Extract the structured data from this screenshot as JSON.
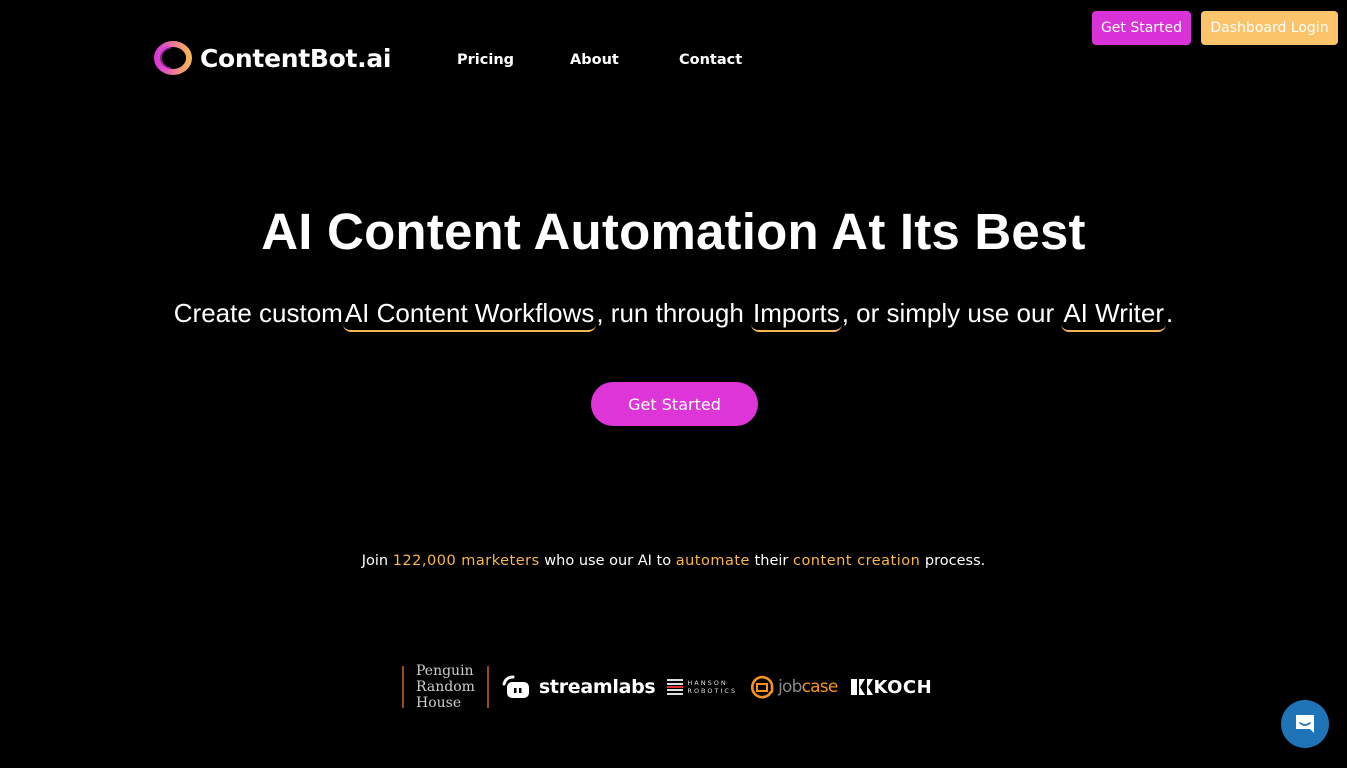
{
  "brand": {
    "name": "ContentBot.ai",
    "colors": {
      "primary": "#d832d8",
      "secondary": "#fbc46a",
      "accent": "#f8b64c",
      "chat": "#1f73b7"
    }
  },
  "nav": {
    "items": [
      {
        "label": "Pricing"
      },
      {
        "label": "About"
      },
      {
        "label": "Contact"
      }
    ]
  },
  "header_buttons": {
    "get_started": "Get Started",
    "dashboard_login": "Dashboard Login"
  },
  "hero": {
    "title": "AI Content Automation At Its Best",
    "subtitle": {
      "part1": "Create custom",
      "highlight1": "AI Content Workflows",
      "part2": ", run through ",
      "highlight2": "Imports",
      "part3": ", or simply use our ",
      "highlight3": "AI Writer",
      "part4": "."
    },
    "cta": "Get Started"
  },
  "social_proof": {
    "join": "Join ",
    "count": "122,000 marketers",
    "t1": " who use our AI to ",
    "automate": "automate",
    "t2": " their ",
    "content_creation": "content creation",
    "t3": " process."
  },
  "client_logos": {
    "penguin": [
      "Penguin",
      "Random",
      "House"
    ],
    "streamlabs": "streamlabs",
    "hanson": [
      "HANSON",
      "ROBOTICS"
    ],
    "jobcase_a": "job",
    "jobcase_b": "case",
    "koch": "KOCH"
  },
  "chat_widget": {
    "icon": "chat-bubble-icon"
  }
}
